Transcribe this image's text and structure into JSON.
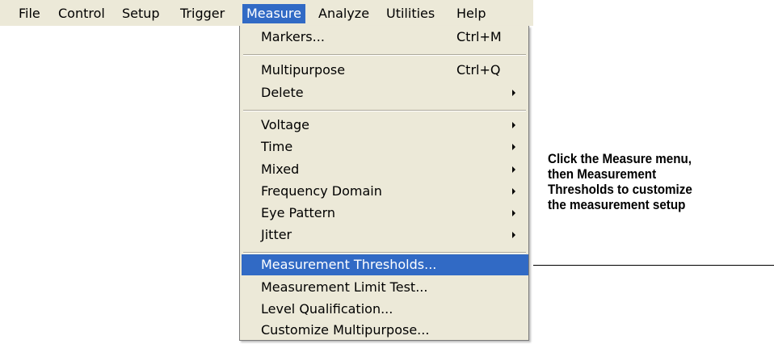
{
  "menubar": {
    "items": [
      "File",
      "Control",
      "Setup",
      "Trigger",
      "Measure",
      "Analyze",
      "Utilities",
      "Help"
    ]
  },
  "menu": {
    "items": [
      {
        "label": "Markers...",
        "shortcut": "Ctrl+M"
      },
      {
        "label": "Multipurpose",
        "shortcut": "Ctrl+Q"
      },
      {
        "label": "Delete",
        "submenu": true
      },
      {
        "label": "Voltage",
        "submenu": true
      },
      {
        "label": "Time",
        "submenu": true
      },
      {
        "label": "Mixed",
        "submenu": true
      },
      {
        "label": "Frequency Domain",
        "submenu": true
      },
      {
        "label": "Eye Pattern",
        "submenu": true
      },
      {
        "label": "Jitter",
        "submenu": true
      },
      {
        "label": "Measurement Thresholds..."
      },
      {
        "label": "Measurement Limit Test..."
      },
      {
        "label": "Level Qualification..."
      },
      {
        "label": "Customize Multipurpose..."
      }
    ]
  },
  "callout": {
    "lines": [
      "Click the Measure menu,",
      "then Measurement",
      "Thresholds to customize",
      "the measurement setup"
    ]
  },
  "colors": {
    "menu_bg": "#ece9d8",
    "highlight": "#316ac5"
  }
}
